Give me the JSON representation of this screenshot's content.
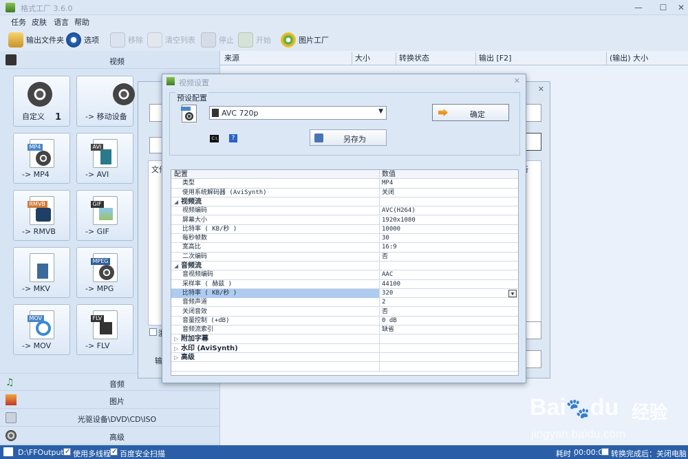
{
  "app": {
    "title": "格式工厂 3.6.0",
    "minimize": "—",
    "maximize": "☐",
    "close": "✕"
  },
  "menu": [
    "任务",
    "皮肤",
    "语言",
    "帮助"
  ],
  "toolbar": {
    "output_folder": "输出文件夹",
    "options": "选项",
    "remove": "移除",
    "clear_list": "清空列表",
    "stop": "停止",
    "start": "开始",
    "picture_factory": "图片工厂"
  },
  "categories": {
    "video": "视频",
    "audio": "音频",
    "picture": "图片",
    "rom": "光驱设备\\DVD\\CD\\ISO",
    "advanced": "高级"
  },
  "formats": [
    {
      "label": "自定义",
      "count": "1"
    },
    {
      "label": "-> 移动设备"
    },
    {
      "label": "-> MP4",
      "tag": "MP4"
    },
    {
      "label": "-> AVI",
      "tag": "AVI"
    },
    {
      "label": "-> RMVB",
      "tag": "RMVB"
    },
    {
      "label": "-> GIF",
      "tag": "GIF"
    },
    {
      "label": "-> MKV",
      "tag": ""
    },
    {
      "label": "-> MPG",
      "tag": "MPEG"
    },
    {
      "label": "-> MOV",
      "tag": "MOV"
    },
    {
      "label": "-> FLV",
      "tag": "FLV"
    }
  ],
  "task_columns": [
    "来源",
    "大小",
    "转换状态",
    "输出 [F2]",
    "(输出) 大小"
  ],
  "bg_dialog": {
    "file_col": "文件",
    "frag": "浙",
    "out": "输",
    "col_right": "新"
  },
  "dialog": {
    "title": "视频设置",
    "preset_label": "预设配置",
    "preset_value": "AVC 720p",
    "ok": "确定",
    "save_as": "另存为",
    "help": "?"
  },
  "grid": {
    "headers": [
      "配置",
      "数值"
    ],
    "rows": [
      {
        "k": "类型",
        "v": "MP4"
      },
      {
        "k": "使用系统解码器 (AviSynth)",
        "v": "关闭"
      },
      {
        "k": "视频流",
        "group": true,
        "open": true
      },
      {
        "k": "视频编码",
        "v": "AVC(H264)"
      },
      {
        "k": "屏幕大小",
        "v": "1920x1080"
      },
      {
        "k": "比特率 ( KB/秒 )",
        "v": "10000"
      },
      {
        "k": "每秒帧数",
        "v": "30"
      },
      {
        "k": "宽高比",
        "v": "16:9"
      },
      {
        "k": "二次编码",
        "v": "否"
      },
      {
        "k": "音频流",
        "group": true,
        "open": true
      },
      {
        "k": "音视频编码",
        "v": "AAC"
      },
      {
        "k": "采样率 ( 赫兹 )",
        "v": "44100"
      },
      {
        "k": "比特率 ( KB/秒 )",
        "v": "320",
        "selected": true
      },
      {
        "k": "音频声道",
        "v": "2"
      },
      {
        "k": "关闭音效",
        "v": "否"
      },
      {
        "k": "音量控制 (+dB)",
        "v": "0 dB"
      },
      {
        "k": "音频流索引",
        "v": "缺省"
      },
      {
        "k": "附加字幕",
        "group": true
      },
      {
        "k": "水印 (AviSynth)",
        "group": true
      },
      {
        "k": "高级",
        "group": true
      }
    ]
  },
  "status": {
    "output_path": "D:\\FFOutput",
    "multithread": "使用多线程",
    "safe_scan": "百度安全扫描",
    "elapsed_label": "耗时 :",
    "elapsed": "00:00:00",
    "after_done": "转换完成后：关闭电脑"
  },
  "watermark": {
    "brand": "Bai",
    "paw": "🐾",
    "brand2": "du",
    "brand_cn": "经验",
    "url": "jingyan.baidu.com"
  },
  "colors": {
    "statusbar": "#2a5fa8",
    "selected_row": "#aecbf0"
  }
}
